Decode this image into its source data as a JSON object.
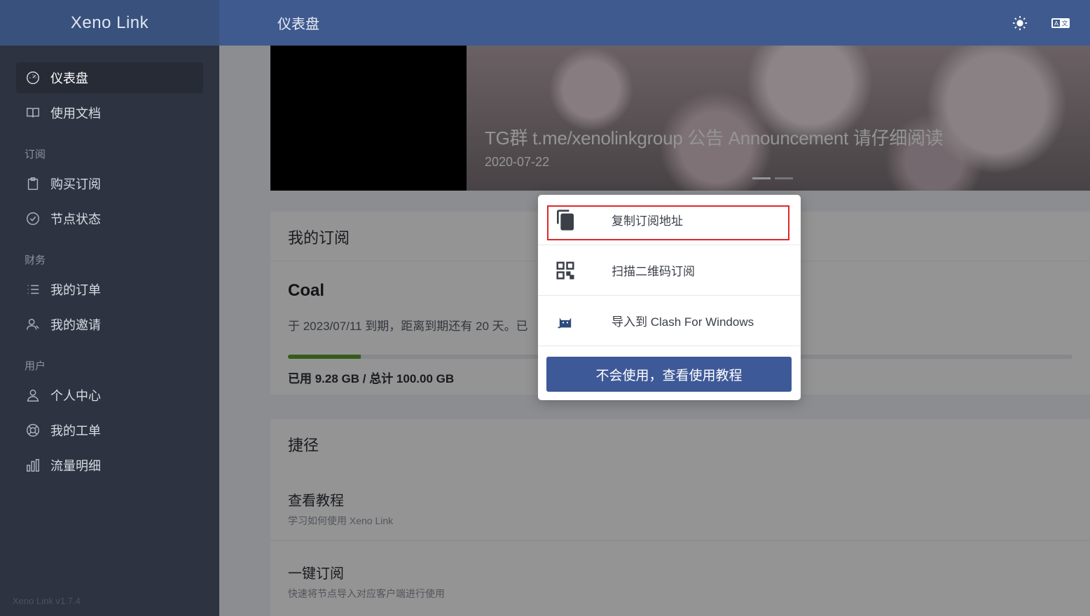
{
  "brand": {
    "name": "Xeno Link",
    "version": "Xeno Link v1.7.4"
  },
  "header": {
    "title": "仪表盘"
  },
  "sidebar": {
    "top_items": [
      {
        "label": "仪表盘",
        "icon": "dashboard-icon",
        "active": true
      },
      {
        "label": "使用文档",
        "icon": "book-icon"
      }
    ],
    "groups": [
      {
        "title": "订阅",
        "items": [
          {
            "label": "购买订阅",
            "icon": "clipboard-icon"
          },
          {
            "label": "节点状态",
            "icon": "check-circle-icon"
          }
        ]
      },
      {
        "title": "财务",
        "items": [
          {
            "label": "我的订单",
            "icon": "list-icon"
          },
          {
            "label": "我的邀请",
            "icon": "user-add-icon"
          }
        ]
      },
      {
        "title": "用户",
        "items": [
          {
            "label": "个人中心",
            "icon": "user-icon"
          },
          {
            "label": "我的工单",
            "icon": "support-icon"
          },
          {
            "label": "流量明细",
            "icon": "bar-chart-icon"
          }
        ]
      }
    ]
  },
  "banner": {
    "title": "TG群 t.me/xenolinkgroup 公告 Announcement 请仔细阅读",
    "date": "2020-07-22"
  },
  "subscription": {
    "title": "我的订阅",
    "plan": "Coal",
    "desc": "于 2023/07/11 到期，距离到期还有 20 天。已",
    "used_fraction": 0.0928,
    "usage": "已用 9.28 GB / 总计 100.00 GB"
  },
  "shortcuts": {
    "title": "捷径",
    "items": [
      {
        "title": "查看教程",
        "desc": "学习如何使用 Xeno Link"
      },
      {
        "title": "一键订阅",
        "desc": "快速将节点导入对应客户端进行使用"
      }
    ]
  },
  "menu": {
    "items": [
      {
        "label": "复制订阅地址",
        "icon": "copy-icon"
      },
      {
        "label": "扫描二维码订阅",
        "icon": "qrcode-icon"
      },
      {
        "label": "导入到 Clash For Windows",
        "icon": "cat-icon"
      }
    ],
    "button": "不会使用，查看使用教程"
  }
}
